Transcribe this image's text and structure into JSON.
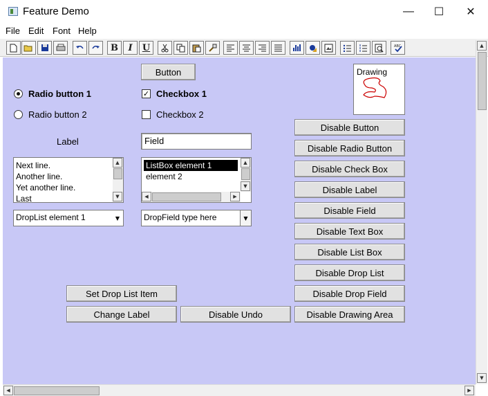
{
  "window": {
    "title": "Feature Demo",
    "minimize_glyph": "—",
    "maximize_glyph": "☐",
    "close_glyph": "✕"
  },
  "menu": [
    "File",
    "Edit",
    "Font",
    "Help"
  ],
  "toolbar": {
    "icons": [
      "new-icon",
      "open-icon",
      "save-icon",
      "print-icon",
      "undo-icon",
      "redo-icon",
      "bold-icon",
      "italic-icon",
      "underline-icon",
      "cut-icon",
      "copy-icon",
      "paste-icon",
      "format-painter-icon",
      "align-left-icon",
      "align-center-icon",
      "align-right-icon",
      "justify-icon",
      "chart-icon",
      "insert-object-icon",
      "image-icon",
      "bullet-list-icon",
      "numbered-list-icon",
      "print-preview-icon",
      "spellcheck-icon"
    ],
    "bold_glyph": "B",
    "italic_glyph": "I",
    "underline_glyph": "U"
  },
  "form": {
    "button_label": "Button",
    "drawing_label": "Drawing",
    "radio1_label": "Radio button 1",
    "radio2_label": "Radio button 2",
    "checkbox1_label": "Checkbox 1",
    "checkbox2_label": "Checkbox 2",
    "check_mark": "✓",
    "label_text": "Label",
    "field_value": "Field",
    "textbox_lines": [
      "Next line.",
      "Another line.",
      "Yet another line.",
      "Last"
    ],
    "listbox_items": [
      "ListBox element 1",
      "element 2"
    ],
    "droplist_value": "DropList element 1",
    "dropfield_value": "DropField type here",
    "drop_arrow": "▼",
    "set_drop_list_item": "Set Drop List Item",
    "change_label": "Change Label",
    "disable_undo": "Disable Undo"
  },
  "disable_buttons": [
    "Disable Button",
    "Disable Radio Button",
    "Disable Check Box",
    "Disable Label",
    "Disable Field",
    "Disable Text Box",
    "Disable List Box",
    "Disable Drop List",
    "Disable Drop Field",
    "Disable Drawing Area"
  ],
  "colors": {
    "client_bg": "#c8c8f6",
    "drawing_stroke": "#cc0000"
  }
}
